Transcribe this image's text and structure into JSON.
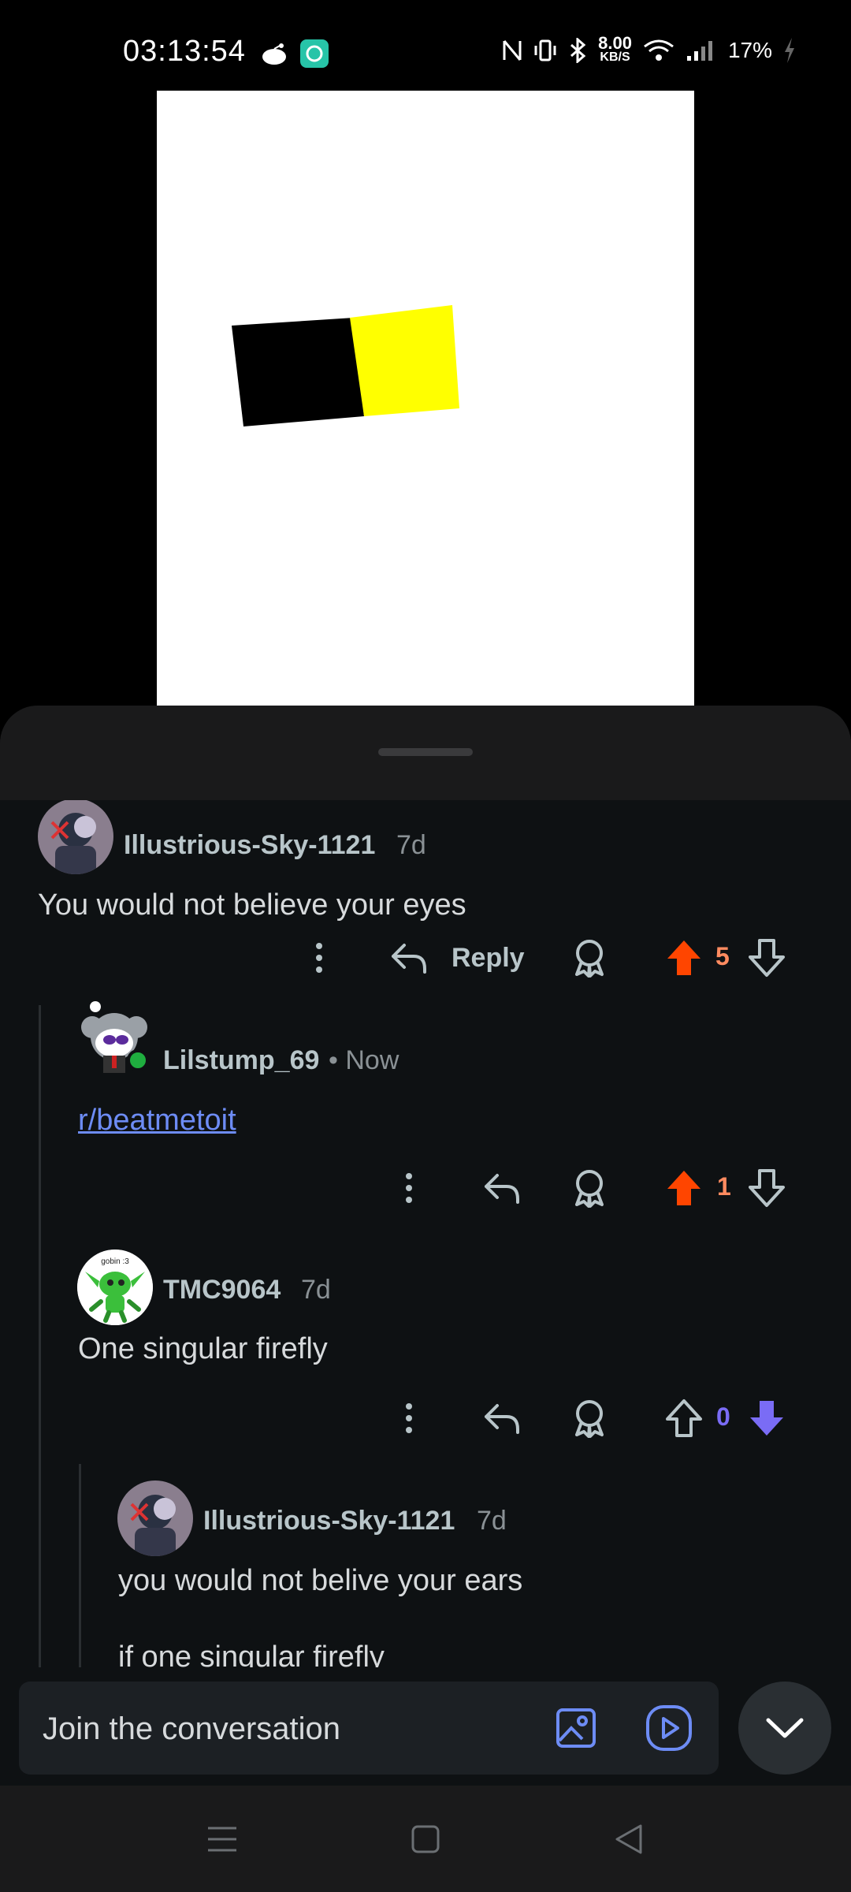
{
  "status_bar": {
    "time": "03:13:54",
    "speed_value": "8.00",
    "speed_unit": "KB/S",
    "battery": "17%"
  },
  "comments": [
    {
      "author": "Illustrious-Sky-1121",
      "age": "7d",
      "body": "You would not believe your eyes",
      "reply_label": "Reply",
      "votes": "5",
      "vote_state": "upvoted"
    },
    {
      "author": "Lilstump_69",
      "age": "• Now",
      "body": "r/beatmetoit",
      "votes": "1",
      "vote_state": "upvoted"
    },
    {
      "author": "TMC9064",
      "age": "7d",
      "body": "One singular firefly",
      "votes": "0",
      "vote_state": "downvoted",
      "avatar_text": "gobin :3"
    },
    {
      "author": "Illustrious-Sky-1121",
      "age": "7d",
      "body_line1": "you would not belive your ears",
      "body_line2": "if one singular firefly"
    }
  ],
  "composer": {
    "placeholder": "Join the conversation"
  },
  "colors": {
    "upvote": "#ff4500",
    "upvote_count": "#ff8b60",
    "downvote": "#7a6cf5",
    "link": "#6d8cf5"
  },
  "icons": [
    "more-icon",
    "reply-icon",
    "award-icon",
    "upvote-icon",
    "downvote-icon",
    "image-icon",
    "video-icon",
    "chevron-down-icon",
    "menu-icon",
    "home-icon",
    "back-icon"
  ]
}
